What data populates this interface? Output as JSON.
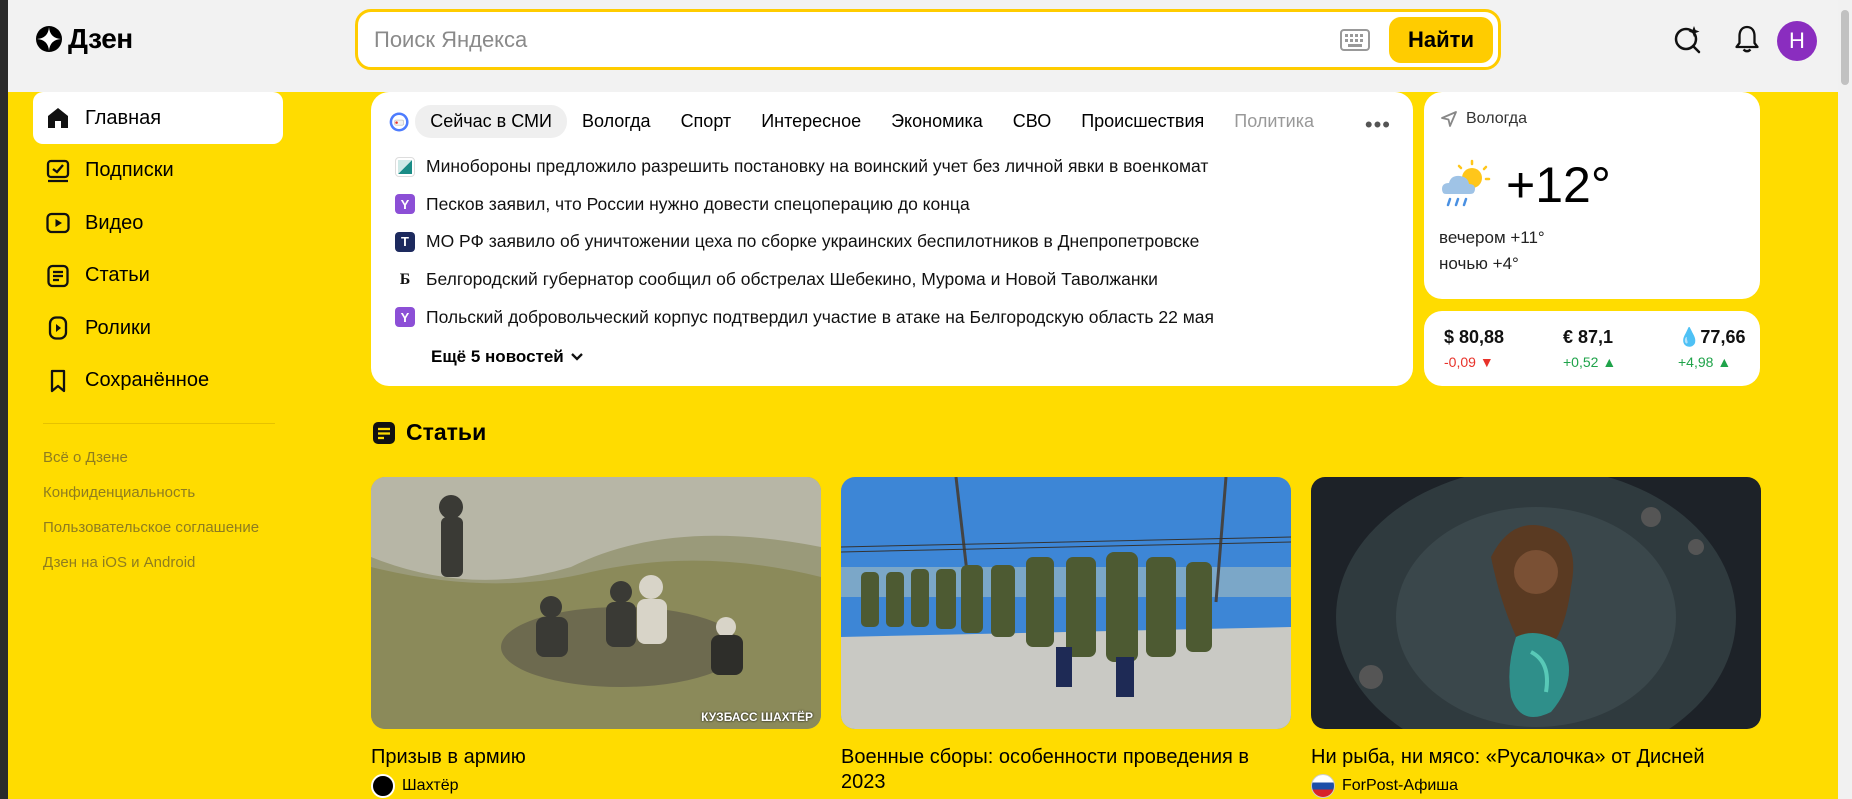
{
  "header": {
    "logo_text": "Дзен",
    "search_placeholder": "Поиск Яндекса",
    "search_button": "Найти",
    "avatar_letter": "Н"
  },
  "sidebar": {
    "items": [
      {
        "label": "Главная",
        "icon": "home-icon"
      },
      {
        "label": "Подписки",
        "icon": "subscriptions-icon"
      },
      {
        "label": "Видео",
        "icon": "video-icon"
      },
      {
        "label": "Статьи",
        "icon": "articles-icon"
      },
      {
        "label": "Ролики",
        "icon": "clips-icon"
      },
      {
        "label": "Сохранённое",
        "icon": "bookmark-icon"
      }
    ],
    "footer_links": [
      "Всё о Дзене",
      "Конфиденциальность",
      "Пользовательское соглашение",
      "Дзен на iOS и Android"
    ]
  },
  "news": {
    "tabs": [
      "Сейчас в СМИ",
      "Вологда",
      "Спорт",
      "Интересное",
      "Экономика",
      "СВО",
      "Происшествия",
      "Политика"
    ],
    "items": [
      "Минобороны предложило разрешить постановку на воинский учет без личной явки в военкомат",
      "Песков заявил, что России нужно довести спецоперацию до конца",
      "МО РФ заявило об уничтожении цеха по сборке украинских беспилотников в Днепропетровске",
      "Белгородский губернатор сообщил об обстрелах Шебекино, Мурома и Новой Таволжанки",
      "Польский добровольческий корпус подтвердил участие в атаке на Белгородскую область 22 мая"
    ],
    "more": "Ещё 5 новостей"
  },
  "weather": {
    "city": "Вологда",
    "temp": "+12°",
    "evening": "вечером +11°",
    "night": "ночью +4°"
  },
  "currency": {
    "usd": {
      "value": "$ 80,88",
      "change": "-0,09"
    },
    "eur": {
      "value": "€ 87,1",
      "change": "+0,52"
    },
    "oil": {
      "value": "77,66",
      "change": "+4,98"
    }
  },
  "articles": {
    "section_title": "Статьи",
    "cards": [
      {
        "title": "Призыв в армию",
        "source": "Шахтёр",
        "watermark": "КУЗБАСС ШАХТЁР"
      },
      {
        "title": "Военные сборы: особенности проведения в 2023",
        "source": ""
      },
      {
        "title": "Ни рыба, ни мясо: «Русалочка» от Дисней",
        "source": "ForPost-Афиша"
      }
    ]
  },
  "colors": {
    "accent": "#ffdc00",
    "button": "#ffcc00",
    "avatar": "#8a2dbf"
  }
}
